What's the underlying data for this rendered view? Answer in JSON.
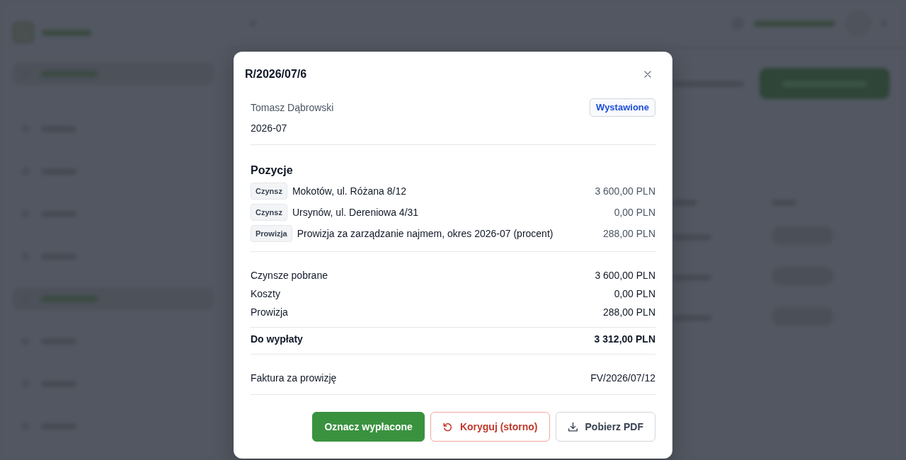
{
  "dialog": {
    "title": "R/2026/07/6"
  },
  "settlement": {
    "owner": "Tomasz Dąbrowski",
    "status": "Wystawione",
    "period": "2026-07"
  },
  "positions": {
    "heading": "Pozycje",
    "items": [
      {
        "tag": "Czynsz",
        "description": "Mokotów, ul. Różana 8/12",
        "amount": "3 600,00 PLN"
      },
      {
        "tag": "Czynsz",
        "description": "Ursynów, ul. Dereniowa 4/31",
        "amount": "0,00 PLN"
      },
      {
        "tag": "Prowizja",
        "description": "Prowizja za zarządzanie najmem, okres 2026-07 (procent)",
        "amount": "288,00 PLN"
      }
    ]
  },
  "summary": [
    {
      "kind": "line",
      "label": "Czynsze pobrane",
      "value": "3 600,00 PLN"
    },
    {
      "kind": "line",
      "label": "Koszty",
      "value": "0,00 PLN"
    },
    {
      "kind": "line",
      "label": "Prowizja",
      "value": "288,00 PLN"
    },
    {
      "kind": "total",
      "label": "Do wypłaty",
      "value": "3 312,00 PLN"
    }
  ],
  "invoice": {
    "label": "Faktura za prowizję",
    "value": "FV/2026/07/12"
  },
  "actions": [
    {
      "kind": "primary",
      "label": "Oznacz wypłacone"
    },
    {
      "kind": "danger",
      "label": "Koryguj (storno)"
    },
    {
      "kind": "secondary",
      "label": "Pobierz PDF"
    }
  ]
}
